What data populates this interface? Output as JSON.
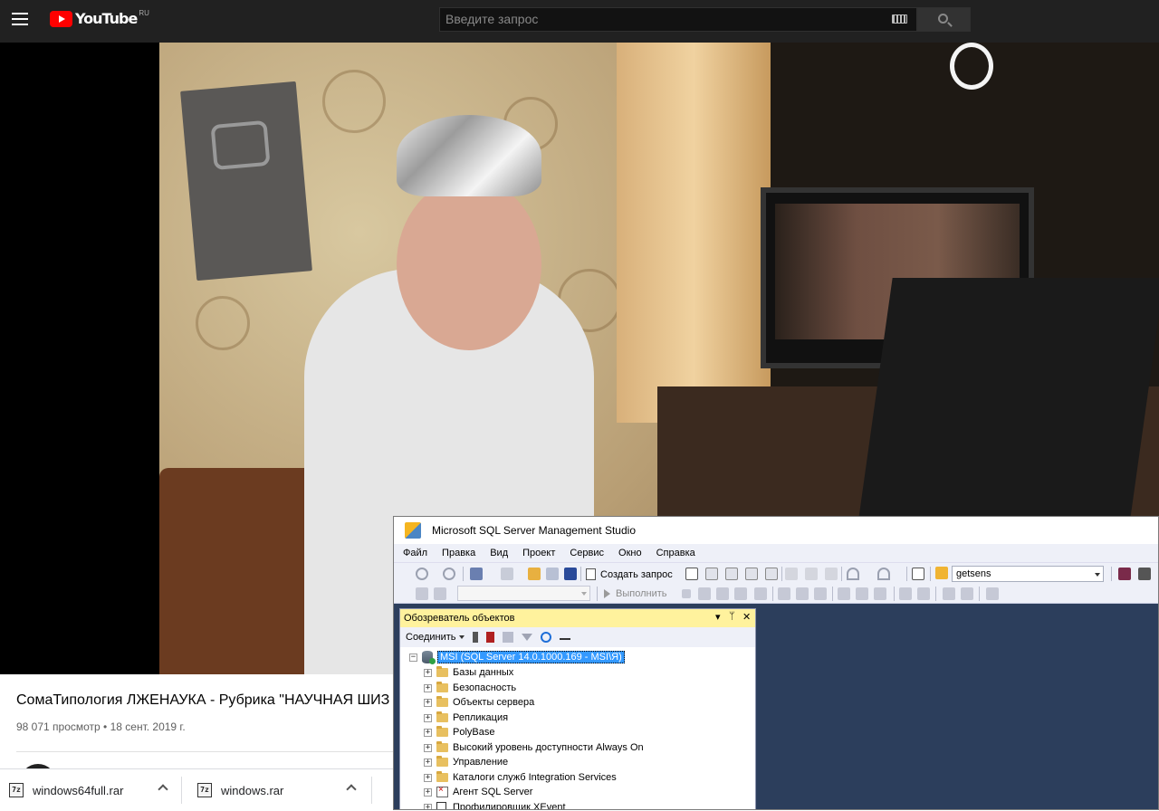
{
  "youtube": {
    "logo_text": "YouTube",
    "region": "RU",
    "search_placeholder": "Введите запрос"
  },
  "video": {
    "title": "СомаТипология ЛЖЕНАУКА - Рубрика \"НАУЧНАЯ ШИЗ",
    "meta": "98 071 просмотр • 18 сент. 2019 г."
  },
  "downloads": [
    {
      "icon": "7z",
      "name": "windows64full.rar"
    },
    {
      "icon": "7z",
      "name": "windows.rar"
    }
  ],
  "ssms": {
    "window_title": "Microsoft SQL Server Management Studio",
    "menu": [
      "Файл",
      "Правка",
      "Вид",
      "Проект",
      "Сервис",
      "Окно",
      "Справка"
    ],
    "toolbar": {
      "new_query_label": "Создать запрос",
      "database": "getsens",
      "execute_label": "Выполнить"
    },
    "object_explorer": {
      "title": "Обозреватель объектов",
      "pin_buttons": [
        "▾",
        "ᛘ",
        "✕"
      ],
      "connect_label": "Соединить",
      "server_node": "MSI (SQL Server 14.0.1000.169 - MSI\\Я)",
      "nodes": [
        "Базы данных",
        "Безопасность",
        "Объекты сервера",
        "Репликация",
        "PolyBase",
        "Высокий уровень доступности Always On",
        "Управление",
        "Каталоги служб Integration Services",
        "Агент SQL Server",
        "Профилировщик XEvent"
      ]
    }
  },
  "colors": {
    "youtube_bar": "#212121",
    "youtube_red": "#ff0000",
    "ssms_background": "#2c3e5c",
    "oe_header": "#fff29d",
    "selection": "#3399ff"
  }
}
